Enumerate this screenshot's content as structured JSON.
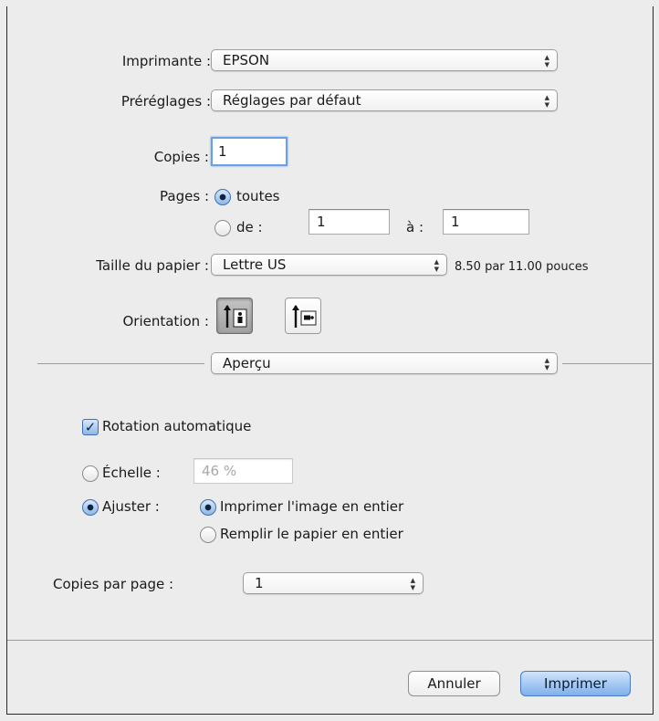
{
  "printer": {
    "label": "Imprimante :",
    "value": "EPSON"
  },
  "presets": {
    "label": "Préréglages :",
    "value": "Réglages par défaut"
  },
  "copies": {
    "label": "Copies :",
    "value": "1"
  },
  "pages": {
    "label": "Pages :",
    "all_label": "toutes",
    "from_label": "de :",
    "from_value": "1",
    "to_label": "à :",
    "to_value": "1",
    "selected": "toutes"
  },
  "paper_size": {
    "label": "Taille du papier :",
    "value": "Lettre US",
    "dimensions": "8.50 par 11.00 pouces"
  },
  "orientation": {
    "label": "Orientation :",
    "selected": "portrait"
  },
  "section_popup": {
    "value": "Aperçu"
  },
  "preview": {
    "auto_rotate_label": "Rotation automatique",
    "auto_rotate_checked": true,
    "scale_label": "Échelle :",
    "scale_value": "46 %",
    "fit_label": "Ajuster :",
    "fit_selected": true,
    "fit_option_1": "Imprimer l'image en entier",
    "fit_option_2": "Remplir le papier en entier",
    "fit_option_selected": "Imprimer l'image en entier",
    "copies_per_page_label": "Copies par page :",
    "copies_per_page_value": "1"
  },
  "buttons": {
    "cancel": "Annuler",
    "print": "Imprimer"
  },
  "icons": {
    "popup_arrows": "up-down-chevrons-icon",
    "portrait": "portrait-orientation-icon",
    "landscape": "landscape-orientation-icon",
    "check": "checkmark-icon"
  },
  "colors": {
    "accent": "#7fb0ea",
    "focus_ring": "#6aa0e6",
    "background": "#ececec"
  }
}
